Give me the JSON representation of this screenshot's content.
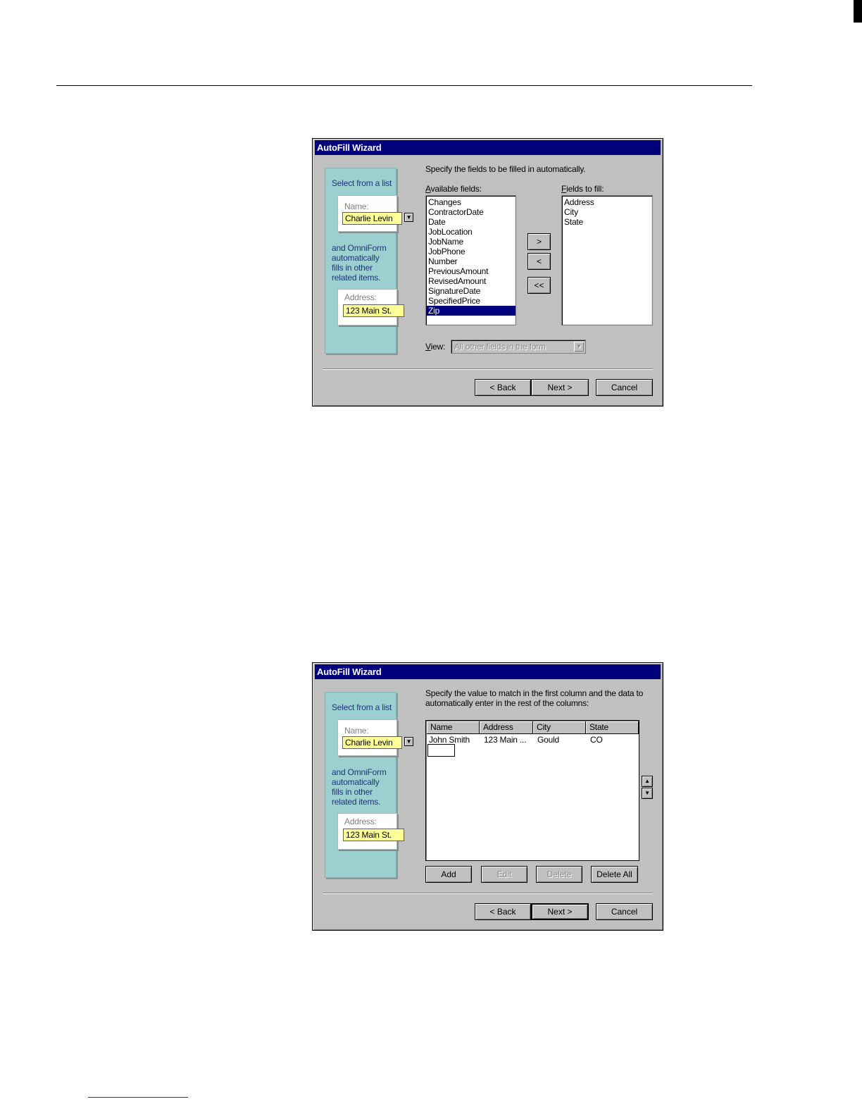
{
  "wizard1": {
    "title": "AutoFill Wizard",
    "illustration": {
      "heading": "Select from a list",
      "name_label": "Name:",
      "name_value": "Charlie Levin",
      "body_lines": [
        "and OmniForm",
        "automatically",
        "fills in other",
        "related items."
      ],
      "address_label": "Address:",
      "address_value": "123 Main St."
    },
    "instruction": "Specify the fields to be filled in automatically.",
    "available_label": "Available fields:",
    "available_fields": [
      "Changes",
      "ContractorDate",
      "Date",
      "JobLocation",
      "JobName",
      "JobPhone",
      "Number",
      "PreviousAmount",
      "RevisedAmount",
      "SignatureDate",
      "SpecifiedPrice",
      "Zip"
    ],
    "selected_field": "Zip",
    "fill_label": "Fields to fill:",
    "fill_fields": [
      "Address",
      "City",
      "State"
    ],
    "move_buttons": {
      "add": ">",
      "remove": "<",
      "remove_all": "<<"
    },
    "view_label": "View:",
    "view_value": "All other fields in the form",
    "buttons": {
      "back": "< Back",
      "next": "Next >",
      "cancel": "Cancel"
    }
  },
  "wizard2": {
    "title": "AutoFill Wizard",
    "illustration": {
      "heading": "Select from a list",
      "name_label": "Name:",
      "name_value": "Charlie Levin",
      "body_lines": [
        "and OmniForm",
        "automatically",
        "fills in other",
        "related items."
      ],
      "address_label": "Address:",
      "address_value": "123 Main St."
    },
    "instruction_lines": [
      "Specify the value to match in the first column and the data to",
      "automatically enter in the rest of the columns:"
    ],
    "columns": [
      "Name",
      "Address",
      "City",
      "State"
    ],
    "rows": [
      [
        "John Smith",
        "123 Main ...",
        "Gould",
        "CO"
      ]
    ],
    "table_buttons": {
      "add": "Add",
      "edit": "Edit",
      "delete": "Delete",
      "delete_all": "Delete All"
    },
    "buttons": {
      "back": "< Back",
      "next": "Next >",
      "cancel": "Cancel"
    }
  }
}
